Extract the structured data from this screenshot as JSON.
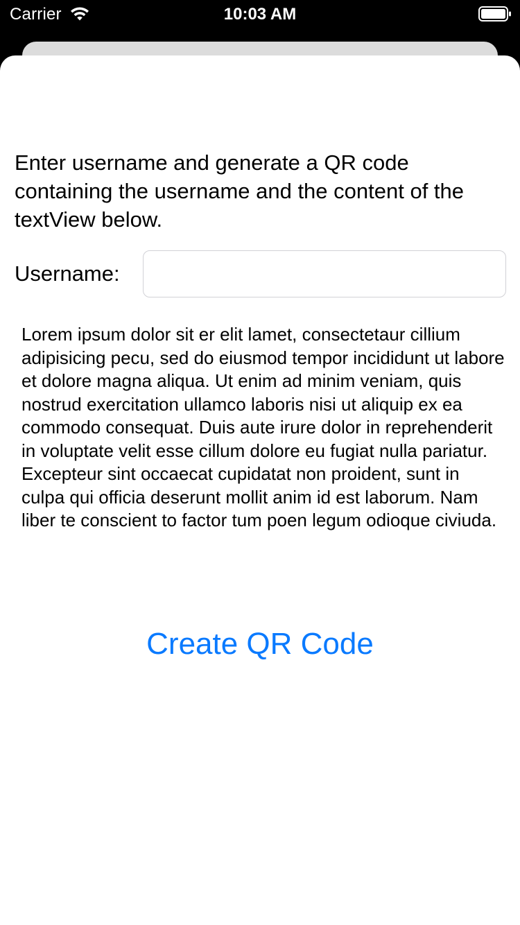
{
  "status_bar": {
    "carrier": "Carrier",
    "time": "10:03 AM",
    "wifi_icon": "wifi-icon",
    "battery_icon": "battery-full-icon"
  },
  "form": {
    "instructions": "Enter username and generate a QR code containing the username and the content of the textView below.",
    "username_label": "Username:",
    "username_value": "",
    "text_view_content": "Lorem ipsum dolor sit er elit lamet, consectetaur cillium adipisicing pecu, sed do eiusmod tempor incididunt ut labore et dolore magna aliqua. Ut enim ad minim veniam, quis nostrud exercitation ullamco laboris nisi ut aliquip ex ea commodo consequat. Duis aute irure dolor in reprehenderit in voluptate velit esse cillum dolore eu fugiat nulla pariatur. Excepteur sint occaecat cupidatat non proident, sunt in culpa qui officia deserunt mollit anim id est laborum. Nam liber te conscient to factor tum poen legum odioque civiuda.",
    "create_button_label": "Create QR Code"
  },
  "colors": {
    "accent": "#0a7aff",
    "background": "#ffffff",
    "status_bar_bg": "#000000"
  }
}
